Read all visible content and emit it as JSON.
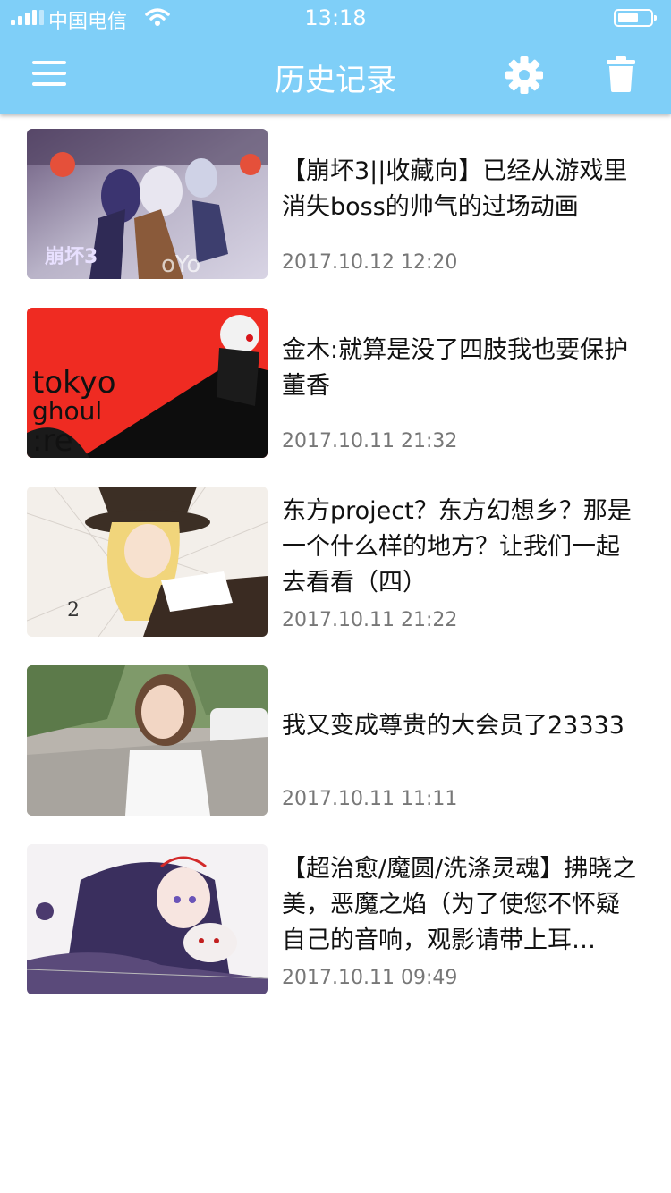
{
  "status_bar": {
    "carrier": "中国电信",
    "time": "13:18"
  },
  "header": {
    "title": "历史记录",
    "menu_icon": "hamburger-menu-icon",
    "settings_icon": "gear-icon",
    "delete_icon": "trash-icon"
  },
  "colors": {
    "header_bg": "#7fcff8",
    "title_text": "#111111",
    "time_text": "#777777"
  },
  "history": [
    {
      "title": "【崩坏3||收藏向】已经从游戏里消失boss的帅气的过场动画",
      "time": "2017.10.12 12:20",
      "thumb": "anime-group-illustration"
    },
    {
      "title": "金木:就算是没了四肢我也要保护董香",
      "time": "2017.10.11 21:32",
      "thumb": "tokyo-ghoul-re-poster"
    },
    {
      "title": "东方project？东方幻想乡？那是一个什么样的地方？让我们一起去看看（四）",
      "time": "2017.10.11 21:22",
      "thumb": "touhou-witch-illustration"
    },
    {
      "title": "我又变成尊贵的大会员了23333",
      "time": "2017.10.11 11:11",
      "thumb": "photo-girl-on-road"
    },
    {
      "title": "【超治愈/魔圆/洗涤灵魂】拂晓之美，恶魔之焰（为了使您不怀疑自己的音响，观影请带上耳…",
      "time": "2017.10.11 09:49",
      "thumb": "anime-girl-lying-illustration"
    }
  ]
}
